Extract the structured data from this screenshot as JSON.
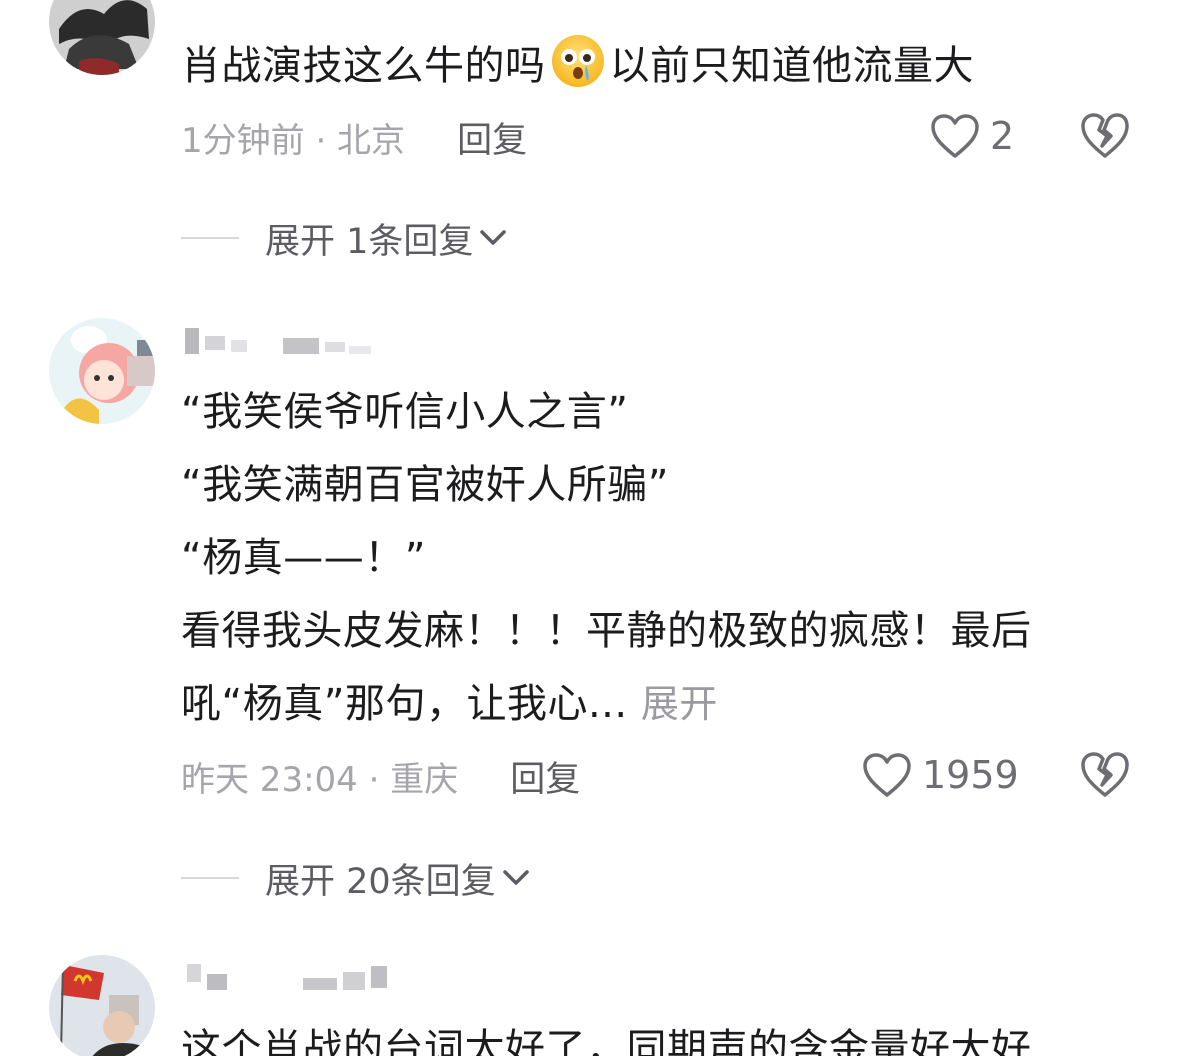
{
  "comments": [
    {
      "username": "",
      "text_before_emoji": "肖战演技这么牛的吗",
      "emoji": "crying-face-emoji",
      "text_after_emoji": "以前只知道他流量大",
      "time_location": "1分钟前 · 北京",
      "reply_label": "回复",
      "like_count": "2",
      "expand_replies": "展开 1条回复"
    },
    {
      "username": "",
      "lines": [
        "“我笑侯爷听信小人之言”",
        "“我笑满朝百官被奸人所骗”",
        "“杨真——！”",
        "看得我头皮发麻！！！平静的极致的疯感！最后",
        "吼“杨真”那句，让我心..."
      ],
      "expand_text": "展开",
      "time_location": "昨天 23:04 · 重庆",
      "reply_label": "回复",
      "like_count": "1959",
      "expand_replies": "展开 20条回复"
    },
    {
      "username": "",
      "text_partial": "这个肖战的台词太好了，同期声的含金量好大好"
    }
  ],
  "colors": {
    "text_primary": "#1c1c1e",
    "text_meta": "#a5a5ab",
    "text_action": "#5c5c62",
    "icon": "#6d6d73"
  }
}
